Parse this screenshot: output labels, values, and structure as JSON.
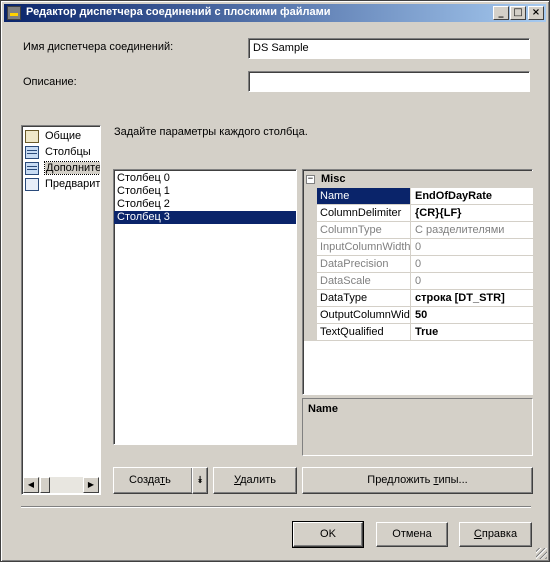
{
  "window": {
    "title": "Редактор диспетчера соединений с плоскими файлами",
    "controls": {
      "minimize": "_",
      "maximize": "□",
      "close": "×"
    }
  },
  "form": {
    "name_label": "Имя диспетчера соединений:",
    "name_value": "DS Sample",
    "description_label": "Описание:",
    "description_value": ""
  },
  "nav": {
    "items": [
      {
        "label": "Общие",
        "icon": "general-icon"
      },
      {
        "label": "Столбцы",
        "icon": "grid-icon"
      },
      {
        "label": "Дополните",
        "icon": "grid-icon",
        "selected": true
      },
      {
        "label": "Предварит",
        "icon": "preview-icon"
      }
    ]
  },
  "main": {
    "instruction": "Задайте параметры каждого столбца.",
    "columns": [
      "Столбец 0",
      "Столбец 1",
      "Столбец 2",
      "Столбец 3"
    ],
    "selected_column_index": 3
  },
  "properties": {
    "category": "Misc",
    "rows": [
      {
        "name": "Name",
        "value": "EndOfDayRate",
        "bold": true,
        "readonly": false,
        "selected": true
      },
      {
        "name": "ColumnDelimiter",
        "value": "{CR}{LF}",
        "bold": true,
        "readonly": false
      },
      {
        "name": "ColumnType",
        "value": "С разделителями",
        "bold": false,
        "readonly": true
      },
      {
        "name": "InputColumnWidth",
        "value": "0",
        "bold": false,
        "readonly": true
      },
      {
        "name": "DataPrecision",
        "value": "0",
        "bold": false,
        "readonly": true
      },
      {
        "name": "DataScale",
        "value": "0",
        "bold": false,
        "readonly": true
      },
      {
        "name": "DataType",
        "value": "строка [DT_STR]",
        "bold": true,
        "readonly": false
      },
      {
        "name": "OutputColumnWid",
        "value": "50",
        "bold": true,
        "readonly": false
      },
      {
        "name": "TextQualified",
        "value": "True",
        "bold": true,
        "readonly": false
      }
    ],
    "description_title": "Name"
  },
  "buttons": {
    "create_pre": "Созда",
    "create_mnemonic": "т",
    "create_post": "ь",
    "delete_mnemonic": "У",
    "delete_post": "далить",
    "suggest_pre": "Предложить ",
    "suggest_mnemonic": "т",
    "suggest_post": "ипы...",
    "ok": "OK",
    "cancel": "Отмена",
    "help_mnemonic": "С",
    "help_post": "правка"
  }
}
